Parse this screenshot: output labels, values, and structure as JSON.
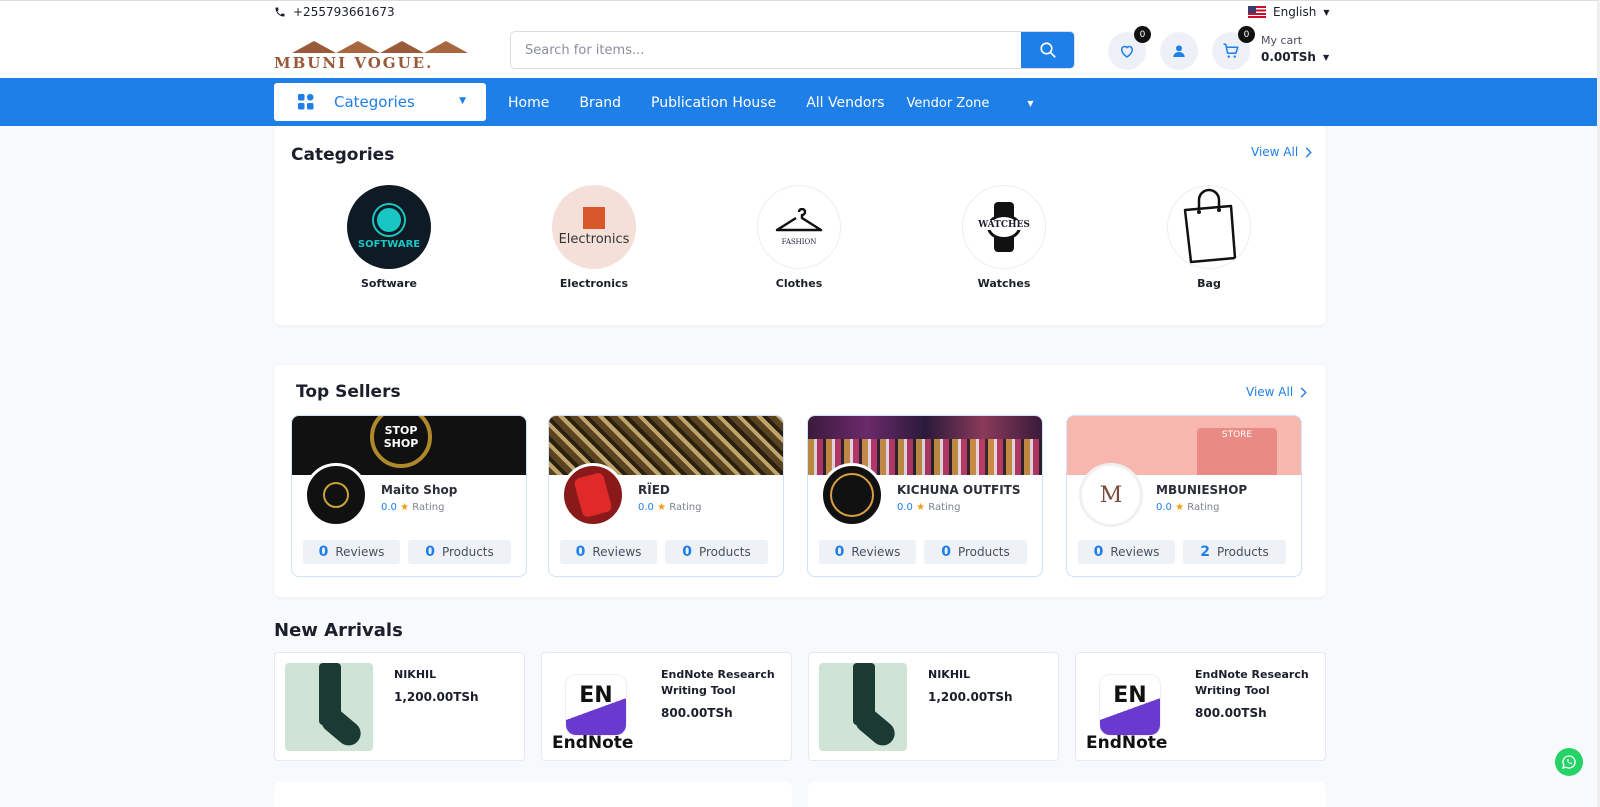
{
  "topbar": {
    "phone": "+255793661673",
    "language": "English"
  },
  "header": {
    "logo_text": "MBUNI VOGUE.",
    "search_placeholder": "Search for items...",
    "wishlist_count": "0",
    "cart_count": "0",
    "cart_label": "My cart",
    "cart_total": "0.00TSh"
  },
  "nav": {
    "categories_label": "Categories",
    "items": [
      "Home",
      "Brand",
      "Publication House",
      "All Vendors"
    ],
    "vendor_zone": "Vendor Zone"
  },
  "categories": {
    "title": "Categories",
    "view_all": "View All",
    "items": [
      {
        "name": "Software",
        "image_text": "SOFTWARE"
      },
      {
        "name": "Electronics",
        "image_text": "Electronics"
      },
      {
        "name": "Clothes",
        "image_text": "FASHION"
      },
      {
        "name": "Watches",
        "image_text": "WATCHES"
      },
      {
        "name": "Bag",
        "image_text": ""
      }
    ]
  },
  "top_sellers": {
    "title": "Top Sellers",
    "view_all": "View All",
    "sellers": [
      {
        "name": "Maito Shop",
        "rating": "0.0",
        "rating_label": "Rating",
        "reviews": "0",
        "reviews_label": "Reviews",
        "products": "0",
        "products_label": "Products",
        "banner_text": "STOP SHOP"
      },
      {
        "name": "RÏED",
        "rating": "0.0",
        "rating_label": "Rating",
        "reviews": "0",
        "reviews_label": "Reviews",
        "products": "0",
        "products_label": "Products",
        "banner_text": ""
      },
      {
        "name": "KICHUNA OUTFITS",
        "rating": "0.0",
        "rating_label": "Rating",
        "reviews": "0",
        "reviews_label": "Reviews",
        "products": "0",
        "products_label": "Products",
        "banner_text": ""
      },
      {
        "name": "MBUNIESHOP",
        "rating": "0.0",
        "rating_label": "Rating",
        "reviews": "0",
        "reviews_label": "Reviews",
        "products": "2",
        "products_label": "Products",
        "banner_text": "STORE"
      }
    ]
  },
  "new_arrivals": {
    "title": "New Arrivals",
    "items": [
      {
        "name": "NIKHIL",
        "price": "1,200.00TSh"
      },
      {
        "name": "EndNote Research Writing Tool",
        "price": "800.00TSh"
      },
      {
        "name": "NIKHIL",
        "price": "1,200.00TSh"
      },
      {
        "name": "EndNote Research Writing Tool",
        "price": "800.00TSh"
      }
    ]
  },
  "colors": {
    "primary": "#1e7fe8",
    "rating_star": "#f39c12",
    "whatsapp": "#25d366"
  }
}
